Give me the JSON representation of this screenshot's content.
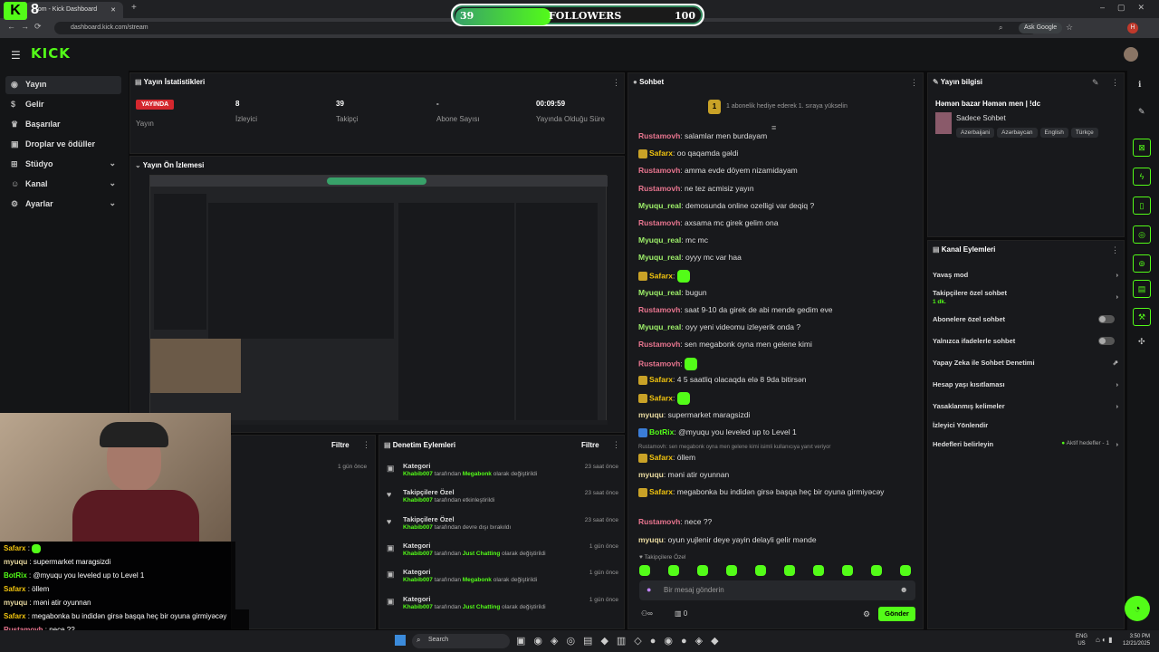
{
  "browser": {
    "tab_title": "...om - Kick Dashboard",
    "url": "dashboard.kick.com/stream",
    "ask_google": "Ask Google"
  },
  "overlay_followers": {
    "current": "39",
    "label": "FOLLOWERS",
    "goal": "100",
    "progress": 0.39
  },
  "kick_logo": "KICK",
  "sidebar": {
    "items": [
      {
        "label": "Yayın"
      },
      {
        "label": "Gelir"
      },
      {
        "label": "Başarılar"
      },
      {
        "label": "Droplar ve ödüller"
      },
      {
        "label": "Stüdyo"
      },
      {
        "label": "Kanal"
      },
      {
        "label": "Ayarlar"
      }
    ]
  },
  "stats": {
    "title": "Yayın İstatistikleri",
    "live": "YAYINDA",
    "live_label": "Yayın",
    "viewers": "8",
    "viewers_label": "İzleyici",
    "followers": "39",
    "followers_label": "Takipçi",
    "subs": "-",
    "subs_label": "Abone Sayısı",
    "duration": "00:09:59",
    "duration_label": "Yayında Olduğu Süre"
  },
  "preview": {
    "title": "Yayın Ön İzlemesi"
  },
  "filter_label": "Filtre",
  "left_event": {
    "time": "1 gün önce"
  },
  "mod_actions": {
    "title": "Denetim Eylemleri",
    "rows": [
      {
        "title": "Kategori",
        "user": "Khabib007",
        "mid": " tarafından ",
        "target": "Megabonk",
        "tail": " olarak değiştirildi",
        "time": "23 saat önce"
      },
      {
        "title": "Takipçilere Özel",
        "user": "Khabib007",
        "mid": " tarafından etkinleştirildi",
        "target": "",
        "tail": "",
        "time": "23 saat önce"
      },
      {
        "title": "Takipçilere Özel",
        "user": "Khabib007",
        "mid": " tarafından devre dışı bırakıldı",
        "target": "",
        "tail": "",
        "time": "23 saat önce"
      },
      {
        "title": "Kategori",
        "user": "Khabib007",
        "mid": " tarafından ",
        "target": "Just Chatting",
        "tail": " olarak değiştirildi",
        "time": "1 gün önce"
      },
      {
        "title": "Kategori",
        "user": "Khabib007",
        "mid": " tarafından ",
        "target": "Megabonk",
        "tail": " olarak değiştirildi",
        "time": "1 gün önce"
      },
      {
        "title": "Kategori",
        "user": "Khabib007",
        "mid": " tarafından ",
        "target": "Just Chatting",
        "tail": " olarak değiştirildi",
        "time": "1 gün önce"
      }
    ]
  },
  "chat": {
    "title": "Sohbet",
    "pinned": "1 abonelik hediye ederek 1. sıraya yükselin",
    "pinned_num": "1",
    "messages": [
      {
        "user": "Rustamovh",
        "text": "salamlar men burdayam"
      },
      {
        "user": "Safarx",
        "text": "oo qaqamda gəldi"
      },
      {
        "user": "Rustamovh",
        "text": "amma evde döyem nizamidayam"
      },
      {
        "user": "Rustamovh",
        "text": "ne tez acmisiz yayın"
      },
      {
        "user": "Myuqu_real",
        "text": "demosunda online ozelligi var deqiq ?"
      },
      {
        "user": "Rustamovh",
        "text": "axsama mc girek gelim ona"
      },
      {
        "user": "Myuqu_real",
        "text": "mc mc"
      },
      {
        "user": "Myuqu_real",
        "text": "oyyy mc var haa"
      },
      {
        "user": "Safarx",
        "text": ""
      },
      {
        "user": "Myuqu_real",
        "text": "bugun"
      },
      {
        "user": "Rustamovh",
        "text": "saat 9-10 da girek de abi mende gedim eve"
      },
      {
        "user": "Myuqu_real",
        "text": "oyy yeni videomu izleyerik onda ?"
      },
      {
        "user": "Rustamovh",
        "text": "sen megabonk oyna men gelene kimi"
      },
      {
        "user": "Rustamovh",
        "text": ""
      },
      {
        "user": "Safarx",
        "text": "4 5 saatliq olacaqda elə 8 9da bitirsən"
      },
      {
        "user": "Safarx",
        "text": ""
      },
      {
        "user": "myuqu",
        "text": "supermarket maragsizdi"
      },
      {
        "user": "BotRix",
        "text": "@myuqu you leveled up to Level 1"
      },
      {
        "reply": "Rustamovh: sen megabonk oyna men gelene kimi isimli kullanıcıya yanıt veriyor"
      },
      {
        "user": "Safarx",
        "text": "öllem"
      },
      {
        "user": "myuqu",
        "text": "məni atir oyunnan"
      },
      {
        "user": "Safarx",
        "text": "megabonka bu indidən girsə başqa heç bir oyuna girmiyəcəy"
      },
      {
        "user": "Rustamovh",
        "text": "nece ??"
      },
      {
        "user": "myuqu",
        "text": "oyun yujlenir deye yayin delayli gelir mənde"
      }
    ],
    "followers_only": "Takipçilere Özel",
    "input_placeholder": "Bir mesaj gönderin",
    "count": "0",
    "send": "Gönder"
  },
  "stream_info": {
    "title": "Yayın bilgisi",
    "stream_title": "Həmən bazar Həmən men | !dc",
    "category": "Sadece Sohbet",
    "tags": [
      "Azerbaijani",
      "Azərbaycan",
      "English",
      "Türkçe"
    ]
  },
  "channel_actions": {
    "title": "Kanal Eylemleri",
    "items": [
      {
        "label": "Yavaş mod"
      },
      {
        "label": "Takipçilere özel sohbet",
        "sub": "1 dk."
      },
      {
        "label": "Abonelere özel sohbet"
      },
      {
        "label": "Yalnızca ifadelerle sohbet"
      },
      {
        "label": "Yapay Zeka ile Sohbet Denetimi"
      },
      {
        "label": "Hesap yaşı kısıtlaması"
      },
      {
        "label": "Yasaklanmış kelimeler"
      },
      {
        "label": "İzleyici Yönlendir"
      },
      {
        "label": "Hedefleri belirleyin",
        "status": "Aktif hedefler - 1"
      }
    ]
  },
  "overlay_chat": [
    {
      "user": "Safarx",
      "text": ""
    },
    {
      "user": "myuqu",
      "text": "supermarket maragsizdi"
    },
    {
      "user": "BotRix",
      "text": "@myuqu you leveled up to Level 1"
    },
    {
      "user": "Safarx",
      "text": "öllem"
    },
    {
      "user": "myuqu",
      "text": "məni atir oyunnan"
    },
    {
      "user": "Safarx",
      "text": "megabonka bu indidən girsə başqa heç bir oyuna girmiyəcəy"
    },
    {
      "user": "Rustamovh",
      "text": "nece ??"
    },
    {
      "user": "myuqu",
      "text": "oyun yujlenir deye yayin delayli gelir mənde"
    }
  ],
  "overlay_logo_num": "8",
  "taskbar": {
    "search": "Search",
    "lang": "ENG",
    "region": "US",
    "time": "3:50 PM",
    "date": "12/21/2025"
  },
  "colors": {
    "accent": "#53fc18",
    "live": "#d4272e"
  }
}
